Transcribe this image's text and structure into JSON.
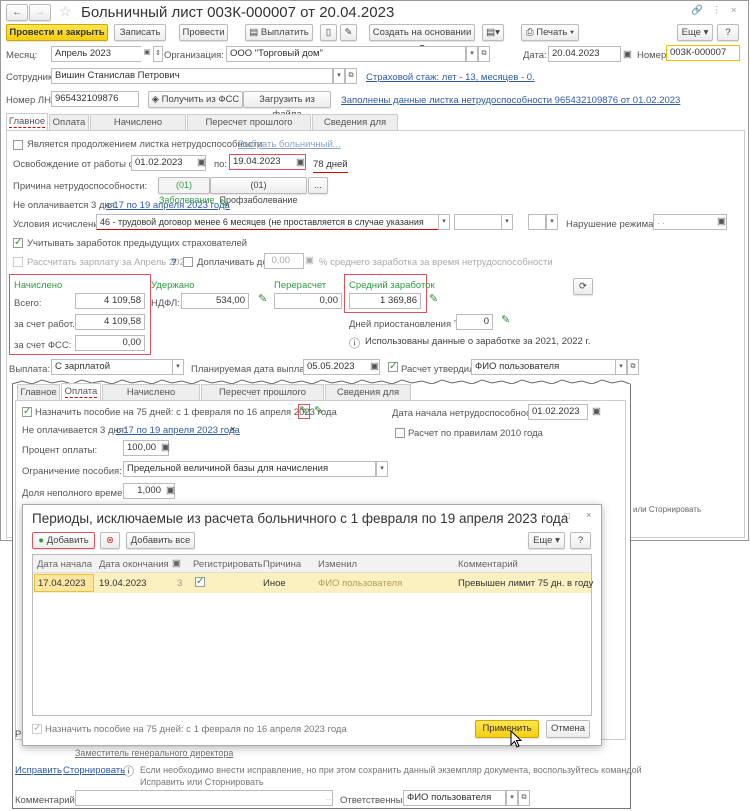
{
  "window": {
    "title": "Больничный лист 003К-000007 от 20.04.2023"
  },
  "toolbar": {
    "post_close": "Провести и закрыть",
    "save": "Записать",
    "post": "Провести",
    "pay": "Выплатить",
    "create_based": "Создать на основании",
    "print": "Печать",
    "more": "Еще",
    "help": "?"
  },
  "header": {
    "month_label": "Месяц:",
    "month": "Апрель 2023",
    "org_label": "Организация:",
    "org": "ООО \"Торговый дом\"",
    "date_label": "Дата:",
    "date": "20.04.2023",
    "number_label": "Номер:",
    "number": "003К-000007",
    "employee_label": "Сотрудник:",
    "employee": "Вишин Станислав Петрович",
    "insurance_link": "Страховой стаж: лет - 13, месяцев - 0.",
    "ln_label": "Номер ЛН:",
    "ln": "965432109876",
    "get_fss": "Получить из ФСС",
    "load_file": "Загрузить из файла",
    "filled_link": "Заполнены данные листка нетрудоспособности 965432109876 от 01.02.2023"
  },
  "tabs": [
    "Главное",
    "Оплата",
    "Начислено (подробно)",
    "Пересчет прошлого периода",
    "Сведения для ФСС"
  ],
  "main": {
    "continuation": "Является продолжением листка нетрудоспособности:",
    "choose_sick": "Выбрать больничный...",
    "release_label": "Освобождение от работы с:",
    "release_from": "01.02.2023",
    "to_label": "по:",
    "release_to": "19.04.2023",
    "days": "78 дней",
    "reason_label": "Причина нетрудоспособности:",
    "reason_1": "(01) Заболевание",
    "reason_2": "(01) Профзаболевание",
    "reason_more": "...",
    "unpaid_label": "Не оплачивается 3 дня:",
    "unpaid_link": "с 17 по 19 апреля 2023 года",
    "conditions_label": "Условия исчисления:",
    "conditions": "46 - трудовой договор менее 6 месяцев (не проставляется в случае указания кода 11 и",
    "violation_label": "Нарушение режима с:",
    "violation": " .  .",
    "consider_prev": "Учитывать заработок предыдущих страхователей",
    "calc_salary": "Рассчитать зарплату за Апрель 2023",
    "q": "?",
    "pay_up_to": "Доплачивать до",
    "pay_up_value": "0,00",
    "pay_up_text": "% среднего заработка за время нетрудоспособности",
    "accrued_title": "Начислено",
    "total_label": "Всего:",
    "total": "4 109,58",
    "employer_label": "за счет работ.:",
    "employer": "4 109,58",
    "fss_label": "за счет ФСС:",
    "fss": "0,00",
    "withheld_title": "Удержано",
    "ndfl_label": "НДФЛ:",
    "ndfl": "534,00",
    "recalc_title": "Перерасчет",
    "recalc": "0,00",
    "avg_title": "Средний заработок",
    "avg": "1 369,86",
    "suspend_label": "Дней приостановления ТД:",
    "suspend": "0",
    "info": "Использованы данные о заработке за  2021,  2022 г.",
    "payout_label": "Выплата:",
    "payout": "С зарплатой",
    "planned_label": "Планируемая дата выплаты:",
    "planned": "05.05.2023",
    "approved_label": "Расчет утвердил",
    "approved": "ФИО пользователя",
    "right_fragment": "или Сторнировать"
  },
  "payment_tab": {
    "assign": "Назначить пособие на 75 дней: с 1 февраля по 16 апреля 2023 года",
    "unpaid_label": "Не оплачивается 3 дня:",
    "unpaid_link": "с 17 по 19 апреля 2023 года",
    "x": "×",
    "start_label": "Дата начала нетрудоспособности:",
    "start": "01.02.2023",
    "rules2010": "Расчет по правилам 2010 года",
    "percent_label": "Процент оплаты:",
    "percent": "100,00",
    "limit_label": "Ограничение пособия:",
    "limit": "Предельной величиной базы для начисления страховых взносо",
    "part_label": "Доля неполного времени:",
    "part": "1,000"
  },
  "dialog": {
    "title": "Периоды, исключаемые из расчета больничного с 1 февраля по 19 апреля 2023 года",
    "add": "Добавить",
    "add_all": "Добавить все",
    "more": "Еще",
    "help": "?",
    "columns": [
      "Дата начала",
      "Дата окончания",
      "",
      "Регистрировать",
      "Причина",
      "Изменил",
      "Комментарий"
    ],
    "rows": [
      {
        "start": "17.04.2023",
        "end": "19.04.2023",
        "days": "3",
        "register": true,
        "reason": "Иное",
        "changed_by": "ФИО пользователя",
        "comment": "Превышен лимит 75 дн. в году"
      }
    ],
    "assign": "Назначить пособие на 75 дней: с 1 февраля по 16 апреля 2023 года",
    "apply": "Применить",
    "cancel": "Отмена"
  },
  "footer": {
    "deputy": "Заместитель генерального директора",
    "fix": "Исправить",
    "reverse": "Сторнировать",
    "info1": "Если необходимо внести исправление, но при этом сохранить данный экземпляр документа, воспользуйтесь командой",
    "info2": "Исправить или Сторнировать",
    "comment_label": "Комментарий:",
    "comment": "",
    "responsible_label": "Ответственный:",
    "responsible": "ФИО пользователя"
  },
  "colors": {
    "accent_yellow": "#f5cf10",
    "highlight_red": "#e0505a",
    "link": "#2d5aa8",
    "green": "#2e9b3f",
    "row_selected": "#fbf0c0"
  }
}
